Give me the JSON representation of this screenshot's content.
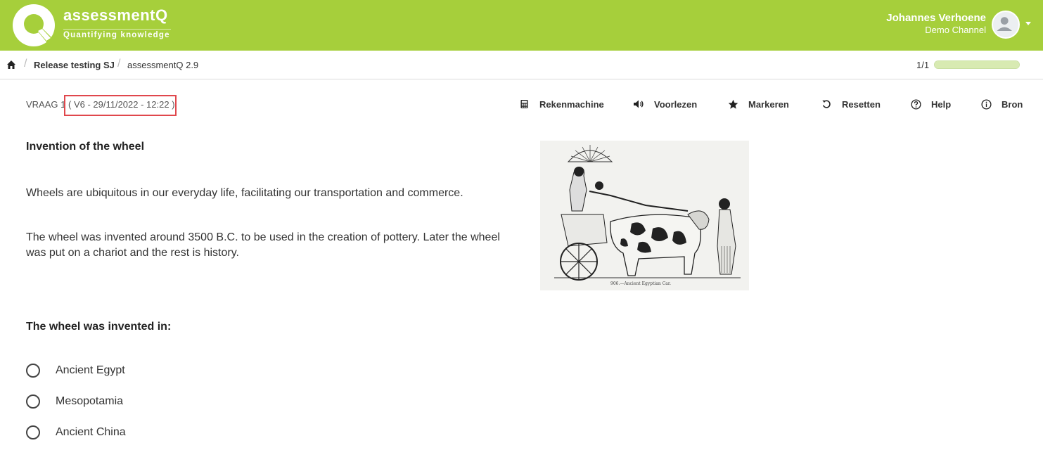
{
  "header": {
    "logo_title": "assessmentQ",
    "logo_tagline": "Quantifying knowledge",
    "user_name": "Johannes Verhoene",
    "user_channel": "Demo Channel",
    "accent_color": "#a6cf3b"
  },
  "breadcrumb": {
    "items": [
      "Release testing SJ",
      "assessmentQ 2.9"
    ]
  },
  "progress": {
    "label": "1/1",
    "fraction": 1.0
  },
  "question_meta": {
    "number_label": "VRAAG 1",
    "version": "( V6 - 29/11/2022 - 12:22 )"
  },
  "toolbar": {
    "calculator": "Rekenmachine",
    "read_aloud": "Voorlezen",
    "mark": "Markeren",
    "reset": "Resetten",
    "help": "Help",
    "source": "Bron"
  },
  "content": {
    "title": "Invention of the wheel",
    "paragraph_1": "Wheels are ubiquitous in our everyday life, facilitating our transportation and commerce.",
    "paragraph_2": "The wheel was invented around 3500 B.C. to be used in the creation of pottery. Later the wheel was put on a chariot and the rest is history.",
    "image_caption": "906.—Ancient Egyptian Car."
  },
  "question": {
    "prompt": "The wheel was invented in:",
    "options": [
      "Ancient Egypt",
      "Mesopotamia",
      "Ancient China"
    ]
  }
}
